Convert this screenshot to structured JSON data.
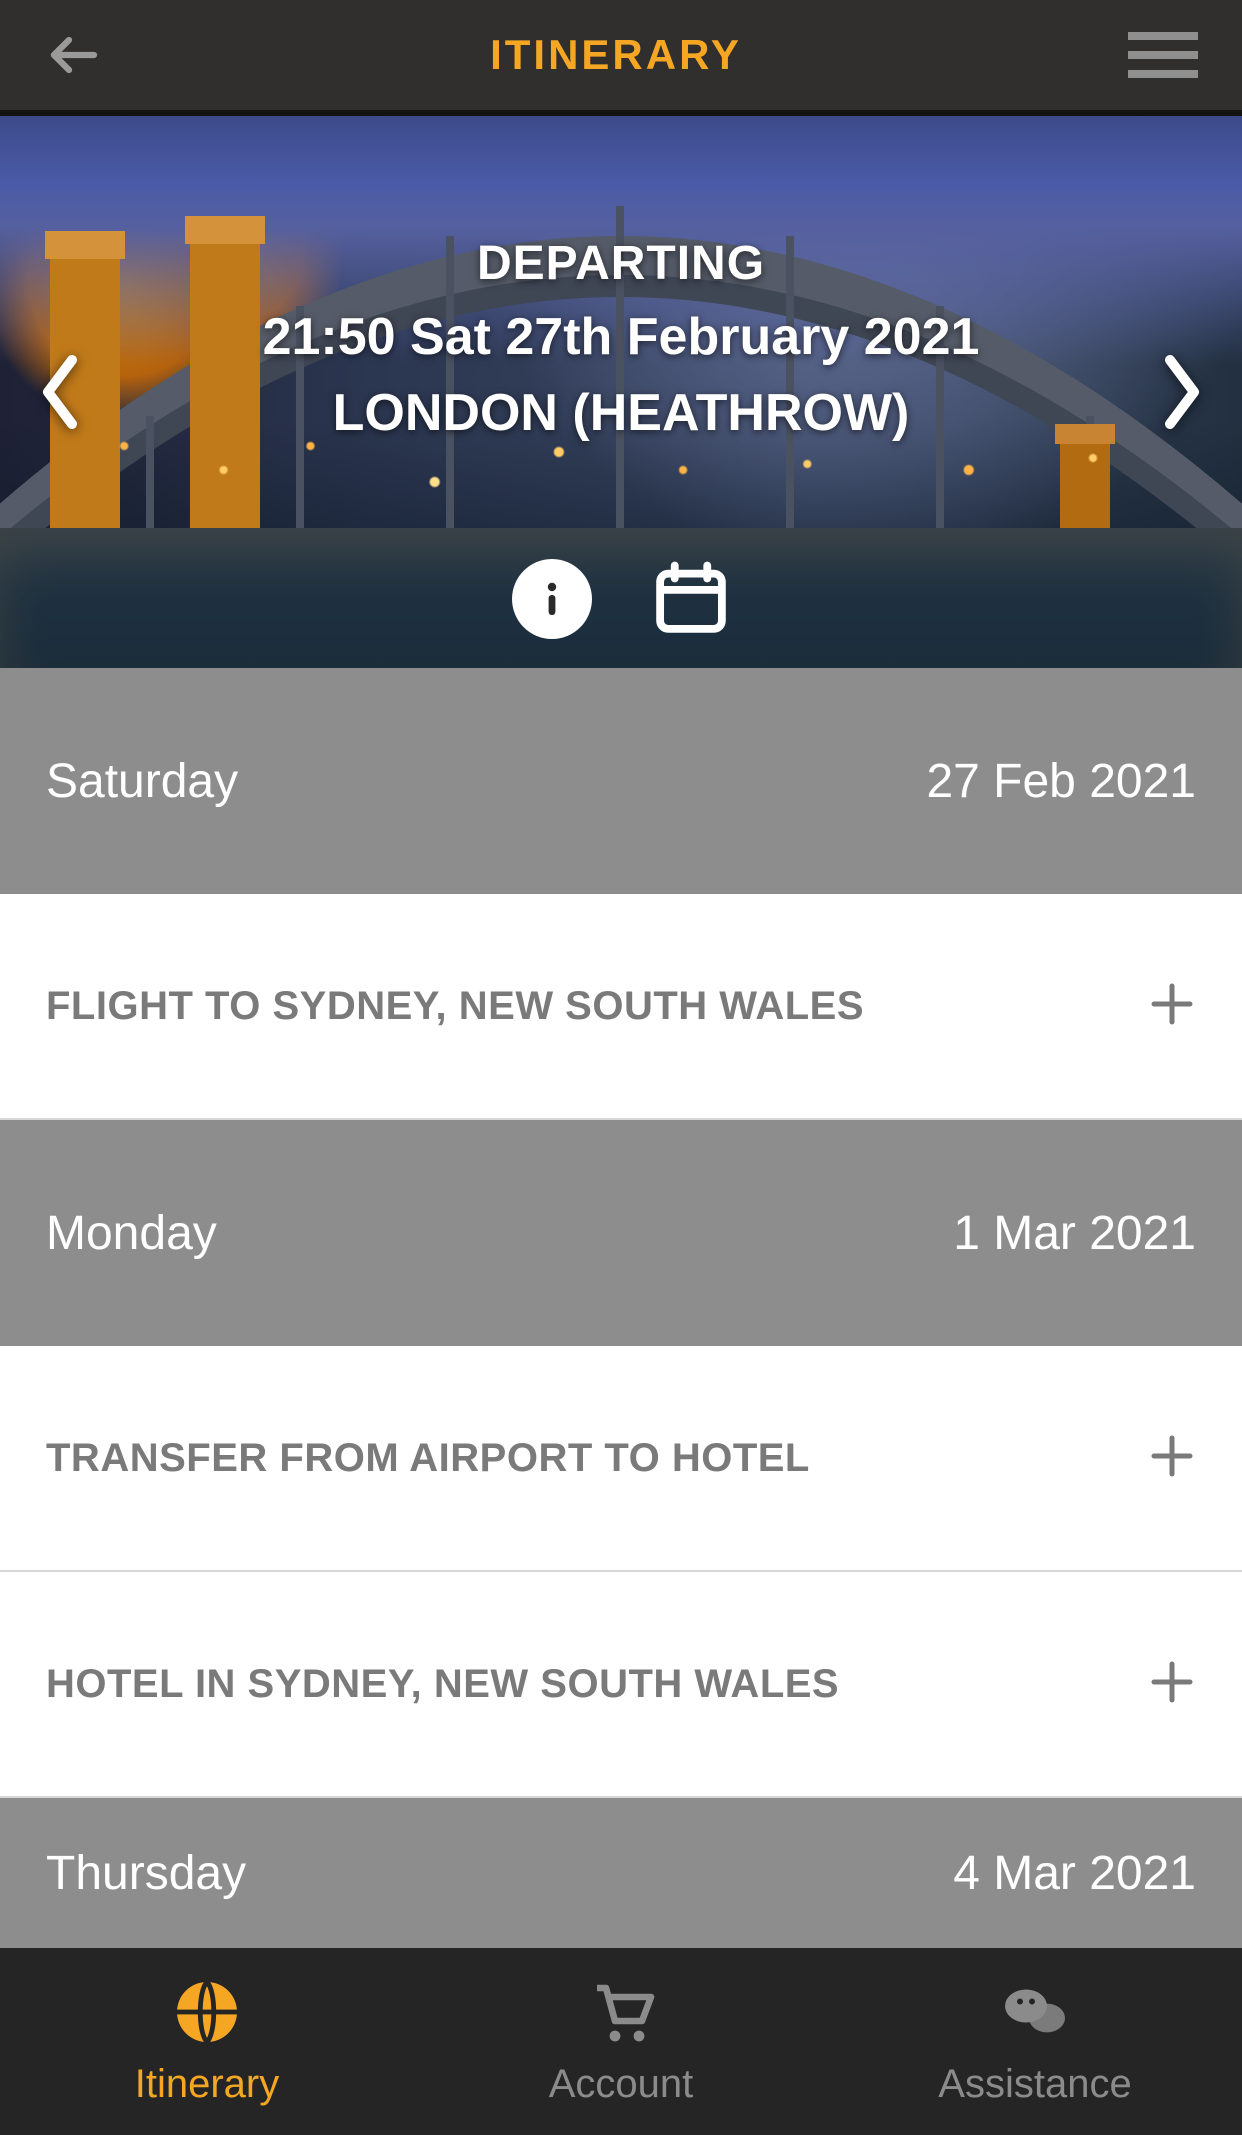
{
  "header": {
    "title": "ITINERARY"
  },
  "hero": {
    "label_departing": "DEPARTING",
    "datetime": "21:50 Sat 27th February 2021",
    "location": "LONDON (HEATHROW)"
  },
  "sections": [
    {
      "kind": "day",
      "name": "Saturday",
      "date": "27 Feb 2021"
    },
    {
      "kind": "item",
      "label": "FLIGHT TO SYDNEY, NEW SOUTH WALES"
    },
    {
      "kind": "day",
      "name": "Monday",
      "date": "1 Mar 2021"
    },
    {
      "kind": "item",
      "label": "TRANSFER FROM AIRPORT TO HOTEL"
    },
    {
      "kind": "item",
      "label": "HOTEL IN SYDNEY, NEW SOUTH WALES"
    },
    {
      "kind": "day",
      "name": "Thursday",
      "date": "4 Mar 2021",
      "short": true
    }
  ],
  "tabs": [
    {
      "label": "Itinerary",
      "icon": "globe",
      "active": true
    },
    {
      "label": "Account",
      "icon": "cart",
      "active": false
    },
    {
      "label": "Assistance",
      "icon": "chat",
      "active": false
    }
  ]
}
